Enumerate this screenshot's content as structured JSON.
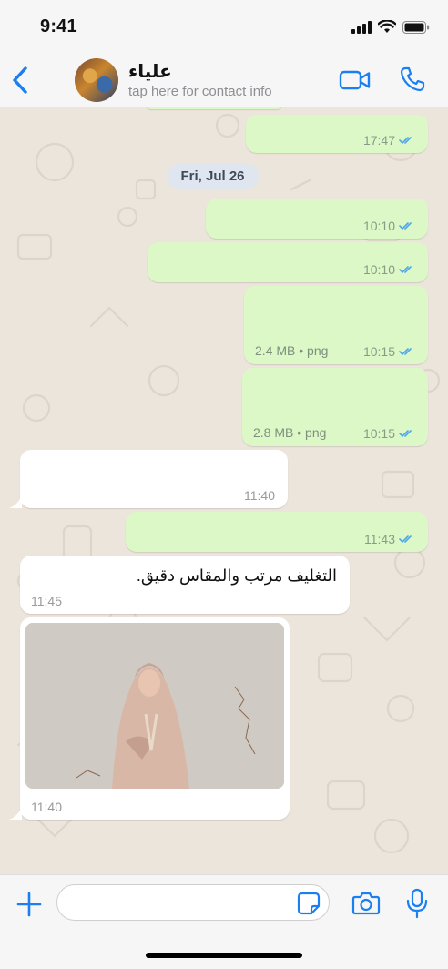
{
  "status_bar": {
    "time": "9:41"
  },
  "header": {
    "contact_name": "علياء",
    "contact_subtitle": "tap here for contact info",
    "icons": [
      "chevron-left-icon",
      "avatar",
      "video-camera-icon",
      "phone-icon"
    ]
  },
  "chat": {
    "date_separator": "Fri, Jul 26",
    "messages": [
      {
        "direction": "out",
        "time": "17:47",
        "status": "read"
      },
      {
        "direction": "out",
        "time": "10:10",
        "status": "read"
      },
      {
        "direction": "out",
        "time": "10:10",
        "status": "read"
      },
      {
        "direction": "out",
        "time": "10:15",
        "status": "read",
        "file_size": "2.4 MB",
        "file_type": "png",
        "separator": "•"
      },
      {
        "direction": "out",
        "time": "10:15",
        "status": "read",
        "file_size": "2.8 MB",
        "file_type": "png",
        "separator": "•"
      },
      {
        "direction": "in",
        "time": "11:40"
      },
      {
        "direction": "out",
        "time": "11:43",
        "status": "read"
      },
      {
        "direction": "in",
        "time": "11:45",
        "text": "التغليف مرتب والمقاس دقيق."
      },
      {
        "direction": "in",
        "time": "11:40",
        "type": "image"
      }
    ]
  },
  "input_bar": {
    "placeholder": "",
    "icons": [
      "plus-icon",
      "sticker-icon",
      "camera-icon",
      "microphone-icon"
    ]
  },
  "colors": {
    "accent": "#1a7ff0",
    "outgoing_bubble": "#dcf8c6",
    "incoming_bubble": "#ffffff",
    "chat_background": "#ece5db",
    "read_ticks": "#4fa7e8"
  }
}
